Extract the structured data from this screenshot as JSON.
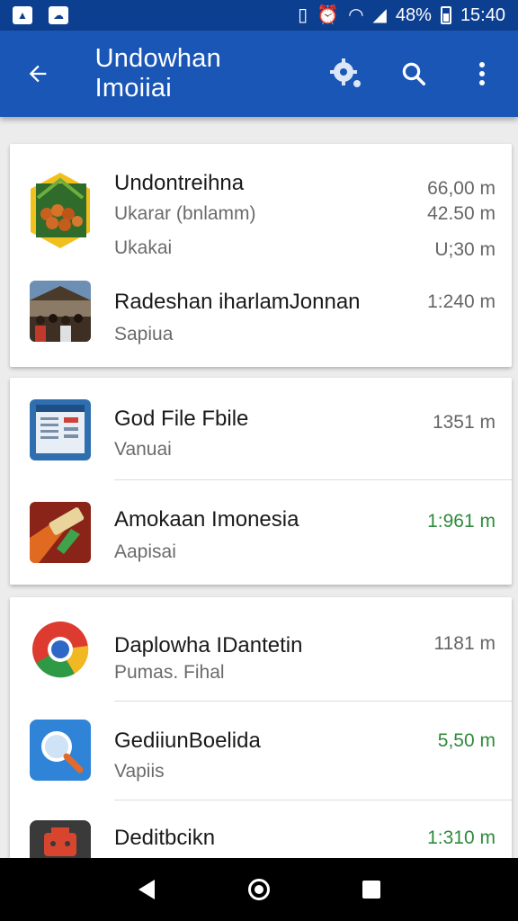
{
  "status_bar": {
    "left_icons": [
      "image-icon",
      "cloud-icon"
    ],
    "right_icons": [
      "vibrate-icon",
      "alarm-icon",
      "wifi-icon",
      "signal-icon"
    ],
    "battery_text": "48%",
    "time": "15:40"
  },
  "app_bar": {
    "title": "Undowhan Imoiiai",
    "icons": [
      "back-arrow-icon",
      "settings-gear-icon",
      "search-icon",
      "overflow-menu-icon"
    ]
  },
  "cards": [
    {
      "items": [
        {
          "title": "Undontreihna",
          "subtitle": "Ukarar (bnlamm)",
          "subtitle2": "Ukakai",
          "meta": [
            "66,00 m",
            "42.50 m",
            "U;30 m"
          ]
        },
        {
          "title": "Radeshan iharlamJonnan",
          "subtitle": "Sapiua",
          "meta": [
            "1:240 m"
          ]
        }
      ]
    },
    {
      "items": [
        {
          "title": "God File Fbile",
          "subtitle": "Vanuai",
          "meta": [
            "1351 m"
          ]
        },
        {
          "title": "Amokaan Imonesia",
          "subtitle": "Aapisai",
          "meta": [
            "1:961 m"
          ]
        }
      ]
    },
    {
      "items": [
        {
          "title": "Daplowha IDantetin",
          "subtitle": "Pumas. Fihal",
          "meta": [
            "1181 m"
          ]
        },
        {
          "title": "GediiunBoelida",
          "subtitle": "Vapiis",
          "meta": [
            "5,50 m"
          ]
        },
        {
          "title": "Deditbcikn",
          "subtitle": "",
          "meta": [
            "1:310 m"
          ]
        }
      ]
    }
  ],
  "colors": {
    "status_bar": "#0d3f91",
    "app_bar": "#1a56b5",
    "background": "#ececec",
    "meta_green": "#2e8b3a"
  },
  "nav_bar": {
    "icons": [
      "back-triangle-icon",
      "home-circle-icon",
      "recents-square-icon"
    ]
  }
}
